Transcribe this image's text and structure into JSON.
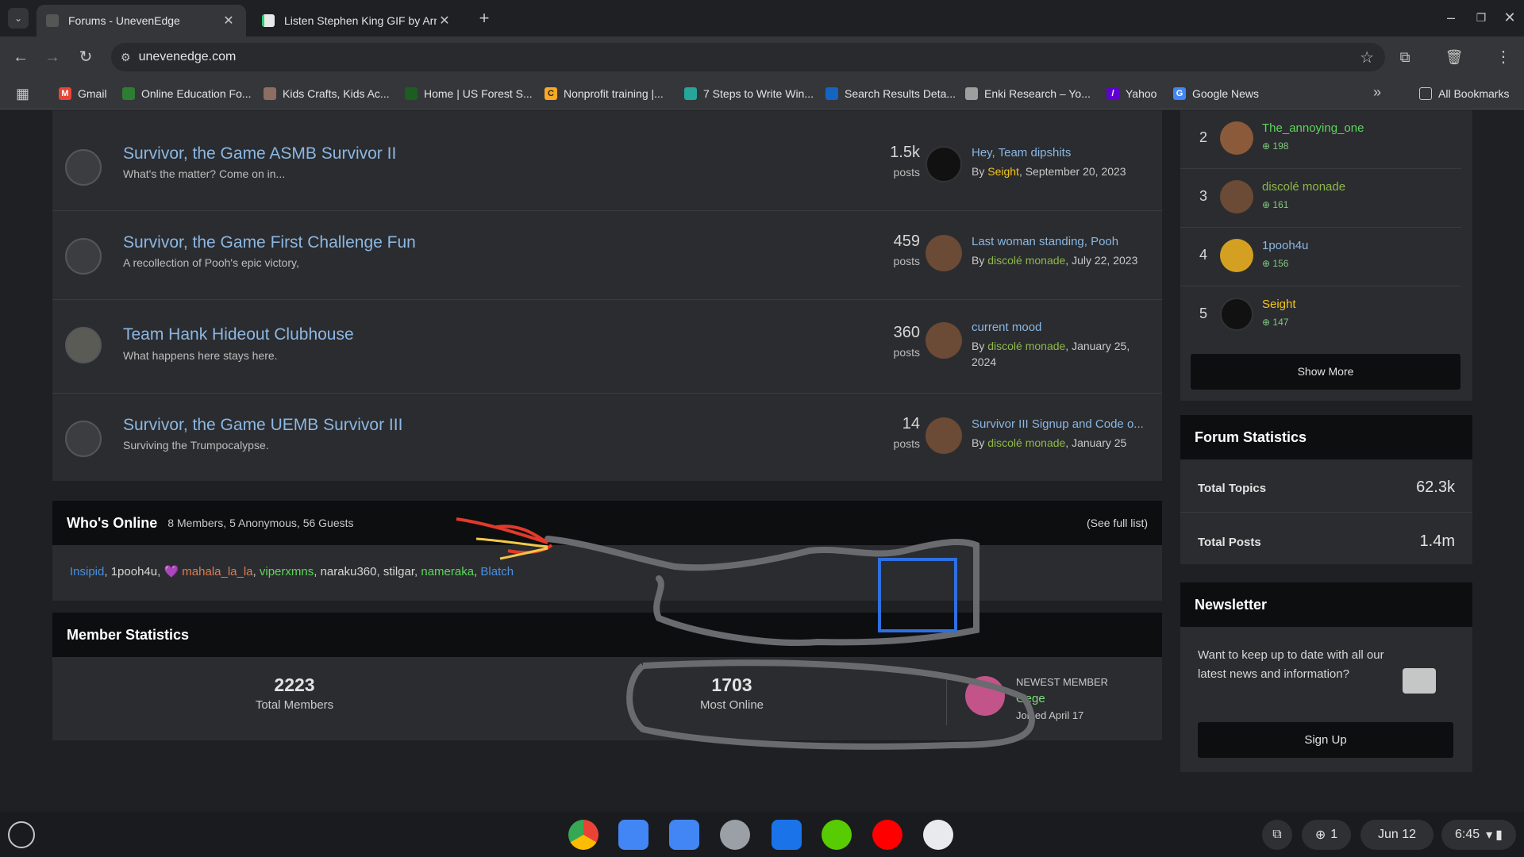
{
  "browser": {
    "tabs": [
      {
        "title": "Forums - UnevenEdge",
        "active": true
      },
      {
        "title": "Listen Stephen King GIF by Arro",
        "active": false
      }
    ],
    "url": "unevenedge.com",
    "bookmarks": [
      {
        "label": "Gmail",
        "icon_color": "#ea4335"
      },
      {
        "label": "Online Education Fo...",
        "icon_color": "#2e7d32"
      },
      {
        "label": "Kids Crafts, Kids Ac...",
        "icon_color": "#8d6e63"
      },
      {
        "label": "Home | US Forest S...",
        "icon_color": "#1b5e20"
      },
      {
        "label": "Nonprofit training |...",
        "icon_color": "#f9a825"
      },
      {
        "label": "7 Steps to Write Win...",
        "icon_color": "#26a69a"
      },
      {
        "label": "Search Results Deta...",
        "icon_color": "#1565c0"
      },
      {
        "label": "Enki Research – Yo...",
        "icon_color": "#9e9e9e"
      },
      {
        "label": "Yahoo",
        "icon_color": "#6001d2"
      },
      {
        "label": "Google News",
        "icon_color": "#4285f4"
      }
    ],
    "all_bookmarks": "All Bookmarks"
  },
  "forums": [
    {
      "title": "Survivor, the Game ASMB Survivor II",
      "desc": "What's the matter?  Come on in...",
      "count": "1.5k",
      "posts_label": "posts",
      "last_title": "Hey, Team dipshits",
      "by": "By",
      "author": "Seight",
      "author_color": "#f5c518",
      "date": ", September 20, 2023"
    },
    {
      "title": "Survivor, the Game First Challenge Fun",
      "desc": "A recollection of Pooh's epic victory,",
      "count": "459",
      "posts_label": "posts",
      "last_title": "Last woman standing, Pooh",
      "by": "By",
      "author": "discolé monade",
      "author_color": "#8fb84a",
      "date": ", July 22, 2023"
    },
    {
      "title": "Team Hank Hideout Clubhouse",
      "desc": "What happens here stays here.",
      "count": "360",
      "posts_label": "posts",
      "last_title": "current mood",
      "by": "By",
      "author": "discolé monade",
      "author_color": "#8fb84a",
      "date": ", January 25, 2024"
    },
    {
      "title": "Survivor, the Game UEMB Survivor III",
      "desc": "Surviving the Trumpocalypse.",
      "count": "14",
      "posts_label": "posts",
      "last_title": "Survivor III Signup and Code o...",
      "by": "By",
      "author": "discolé monade",
      "author_color": "#8fb84a",
      "date": ", January 25"
    }
  ],
  "whos_online": {
    "title": "Who's Online",
    "summary": "8 Members, 5 Anonymous, 56 Guests",
    "see_full": "(See full list)",
    "members": [
      {
        "name": "Insipid",
        "color": "#4a90e2"
      },
      {
        "name": "1pooh4u",
        "color": "#d7d7d7"
      },
      {
        "name": "💜 mahala_la_la",
        "color": "#e07b53"
      },
      {
        "name": "viperxmns",
        "color": "#5cd65c"
      },
      {
        "name": "naraku360",
        "color": "#d7d7d7"
      },
      {
        "name": "stilgar",
        "color": "#d7d7d7"
      },
      {
        "name": "nameraka",
        "color": "#5cd65c"
      },
      {
        "name": "Blatch",
        "color": "#4a90e2"
      }
    ]
  },
  "member_stats": {
    "title": "Member Statistics",
    "total_members": "2223",
    "total_members_label": "Total Members",
    "most_online": "1703",
    "most_online_label": "Most Online",
    "newest_label": "NEWEST MEMBER",
    "newest_name": "Gege",
    "joined": "Joined April 17"
  },
  "leaderboard": [
    {
      "rank": "2",
      "name": "The_annoying_one",
      "rep": "198",
      "color": "#5cd65c"
    },
    {
      "rank": "3",
      "name": "discolé monade",
      "rep": "161",
      "color": "#8fb84a"
    },
    {
      "rank": "4",
      "name": "1pooh4u",
      "rep": "156",
      "color": "#8bb7e3"
    },
    {
      "rank": "5",
      "name": "Seight",
      "rep": "147",
      "color": "#f5c518"
    }
  ],
  "show_more": "Show More",
  "forum_stats": {
    "title": "Forum Statistics",
    "topics_label": "Total Topics",
    "topics": "62.3k",
    "posts_label": "Total Posts",
    "posts": "1.4m"
  },
  "newsletter": {
    "title": "Newsletter",
    "text": "Want to keep up to date with all our latest news and information?",
    "button": "Sign Up"
  },
  "shelf": {
    "date": "Jun 12",
    "time": "6:45",
    "notif_count": "1"
  }
}
